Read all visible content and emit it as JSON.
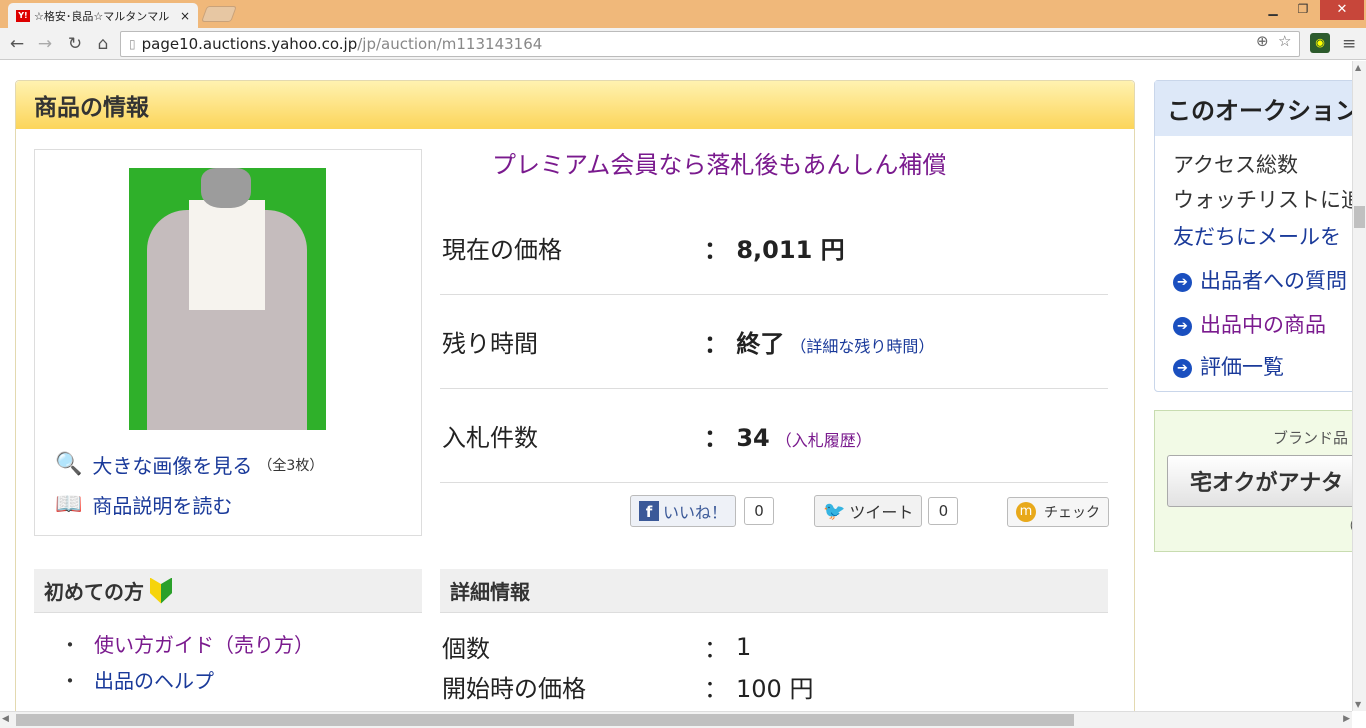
{
  "browser": {
    "tab_title": "☆格安･良品☆マルタンマル",
    "tab_close": "×",
    "url_domain": "page10.auctions.yahoo.co.jp",
    "url_path": "/jp/auction/m113143164",
    "favicon_text": "Y!"
  },
  "panel": {
    "title": "商品の情報"
  },
  "image_links": [
    {
      "label": "大きな画像を見る",
      "note": "（全3枚）"
    },
    {
      "label": "商品説明を読む",
      "note": ""
    }
  ],
  "promo": "プレミアム会員なら落札後もあんしん補償",
  "summary": [
    {
      "label": "現在の価格",
      "colon": "：",
      "value": "8,011 円",
      "sub": ""
    },
    {
      "label": "残り時間",
      "colon": "：",
      "value": "終了",
      "sub": "（詳細な残り時間）"
    },
    {
      "label": "入札件数",
      "colon": "：",
      "value": "34",
      "sub": "（入札履歴）"
    }
  ],
  "social": {
    "like_label": "いいね！",
    "like_count": "0",
    "tweet_label": "ツイート",
    "tweet_count": "0",
    "check_label": "チェック"
  },
  "beginner": {
    "title": "初めての方",
    "items": [
      "使い方ガイド（売り方）",
      "出品のヘルプ"
    ]
  },
  "details": {
    "title": "詳細情報",
    "rows": [
      {
        "label": "個数",
        "colon": "：",
        "value": "1"
      },
      {
        "label": "開始時の価格",
        "colon": "：",
        "value": "100 円"
      }
    ]
  },
  "sidebar": {
    "title": "このオークション",
    "lines": [
      "アクセス総数",
      "ウォッチリストに追",
      "友だちにメールを"
    ],
    "links": [
      "出品者への質問",
      "出品中の商品",
      "評価一覧"
    ]
  },
  "brand_box": {
    "label": "ブランド品",
    "button": "宅オクがアナタ",
    "paren": "（"
  }
}
